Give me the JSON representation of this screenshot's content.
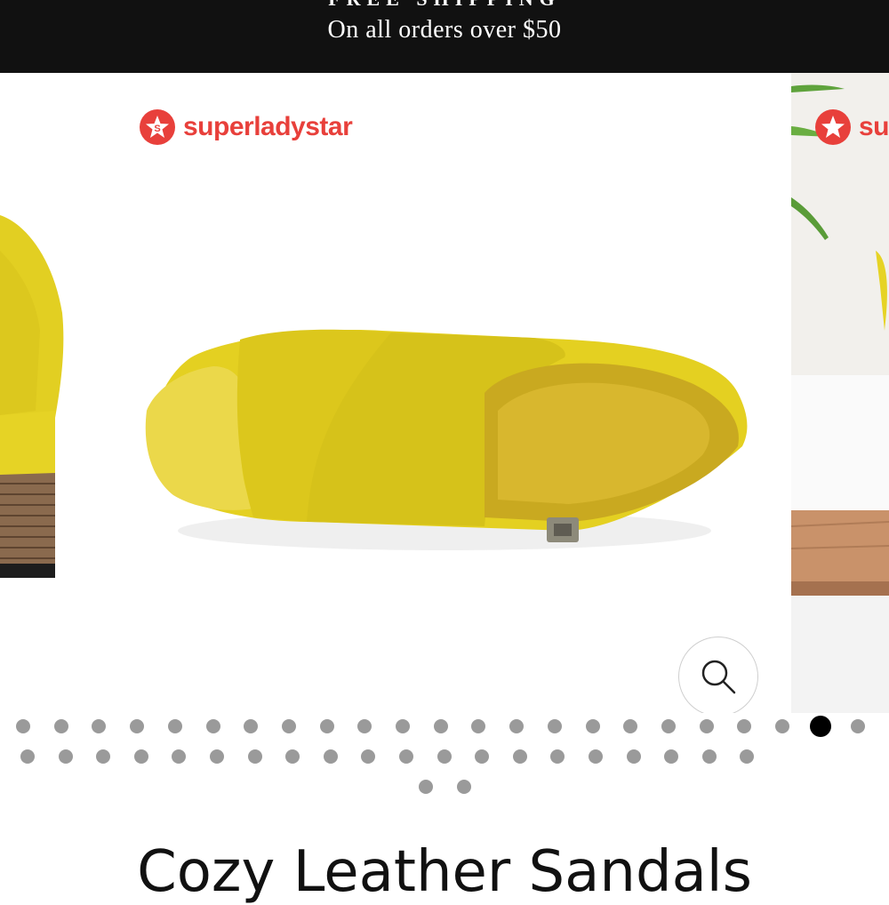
{
  "announcement": {
    "headline": "FREE SHIPPING",
    "subtext": "On all orders over $50"
  },
  "gallery": {
    "brand_logo_text": "superladystar",
    "zoom_icon": "search-icon",
    "accent_color": "#e8403b",
    "shoe_color": "#e8d52a",
    "total_slides": 45,
    "active_slide_index": 21
  },
  "product": {
    "title": "Cozy Leather Sandals"
  }
}
